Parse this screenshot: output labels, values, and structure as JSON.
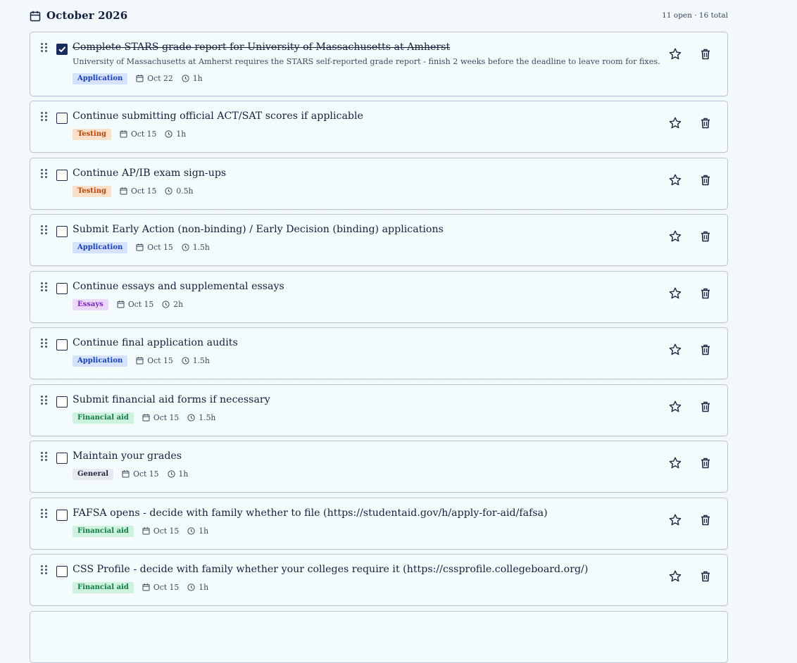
{
  "header": {
    "month": "October 2026",
    "summary": "11 open · 16 total"
  },
  "colors": {
    "Application": {
      "bg": "#d5e2fd",
      "fg": "#1a3fb8"
    },
    "Testing": {
      "bg": "#fbe0c9",
      "fg": "#b34509"
    },
    "Essays": {
      "bg": "#ecd8fb",
      "fg": "#7a23bb"
    },
    "Financial aid": {
      "bg": "#cdf2df",
      "fg": "#137a45"
    },
    "General": {
      "bg": "#e6e9ef",
      "fg": "#1e293b"
    }
  },
  "tasks": [
    {
      "title": "Complete STARS grade report for University of Massachusetts at Amherst",
      "description": "University of Massachusetts at Amherst requires the STARS self-reported grade report - finish 2 weeks before the deadline to leave room for fixes.",
      "category": "Application",
      "date": "Oct 22",
      "duration": "1h",
      "done": true
    },
    {
      "title": "Continue submitting official ACT/SAT scores if applicable",
      "category": "Testing",
      "date": "Oct 15",
      "duration": "1h",
      "done": false
    },
    {
      "title": "Continue AP/IB exam sign-ups",
      "category": "Testing",
      "date": "Oct 15",
      "duration": "0.5h",
      "done": false
    },
    {
      "title": "Submit Early Action (non-binding) / Early Decision (binding) applications",
      "category": "Application",
      "date": "Oct 15",
      "duration": "1.5h",
      "done": false
    },
    {
      "title": "Continue essays and supplemental essays",
      "category": "Essays",
      "date": "Oct 15",
      "duration": "2h",
      "done": false
    },
    {
      "title": "Continue final application audits",
      "category": "Application",
      "date": "Oct 15",
      "duration": "1.5h",
      "done": false
    },
    {
      "title": "Submit financial aid forms if necessary",
      "category": "Financial aid",
      "date": "Oct 15",
      "duration": "1.5h",
      "done": false
    },
    {
      "title": "Maintain your grades",
      "category": "General",
      "date": "Oct 15",
      "duration": "1h",
      "done": false
    },
    {
      "title": "FAFSA opens - decide with family whether to file (https://studentaid.gov/h/apply-for-aid/fafsa)",
      "category": "Financial aid",
      "date": "Oct 15",
      "duration": "1h",
      "done": false
    },
    {
      "title": "CSS Profile - decide with family whether your colleges require it (https://cssprofile.collegeboard.org/)",
      "category": "Financial aid",
      "date": "Oct 15",
      "duration": "1h",
      "done": false
    },
    {
      "title": "",
      "category": "",
      "date": "",
      "duration": "",
      "done": false
    }
  ]
}
